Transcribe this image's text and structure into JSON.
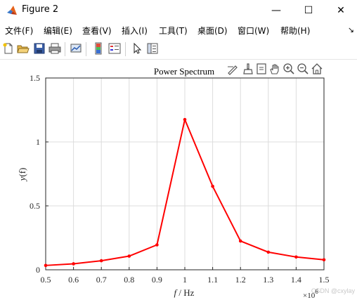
{
  "window": {
    "title": "Figure 2",
    "minimize": "—",
    "maximize": "☐",
    "close": "✕"
  },
  "menu": {
    "items": [
      "文件(F)",
      "编辑(E)",
      "查看(V)",
      "插入(I)",
      "工具(T)",
      "桌面(D)",
      "窗口(W)",
      "帮助(H)"
    ],
    "overflow": "↘"
  },
  "toolbar": {
    "icons": [
      "new-figure-icon",
      "open-file-icon",
      "save-icon",
      "print-icon",
      "link-plot-icon",
      "insert-colorbar-icon",
      "insert-legend-icon",
      "pointer-icon",
      "property-inspector-icon"
    ]
  },
  "axes_toolbar": {
    "icons": [
      "data-tips-icon",
      "brush-icon",
      "export-icon",
      "pan-hand-icon",
      "zoom-in-icon",
      "zoom-out-icon",
      "home-icon"
    ]
  },
  "watermark": "CSDN @cxylay",
  "colors": {
    "line": "#ff0000",
    "grid": "#dcdcdc",
    "axis": "#262626"
  },
  "chart_data": {
    "type": "line",
    "title": "Power Spectrum",
    "xlabel_italic": "f",
    "xlabel_rest": " / Hz",
    "ylabel_italic": "y",
    "ylabel_rest": "(f)",
    "x_exponent_label": "×10",
    "x_exponent": "6",
    "xlim": [
      0.5,
      1.5
    ],
    "ylim": [
      0,
      1.5
    ],
    "xticks": [
      "0.5",
      "0.6",
      "0.7",
      "0.8",
      "0.9",
      "1",
      "1.1",
      "1.2",
      "1.3",
      "1.4",
      "1.5"
    ],
    "yticks": [
      "0",
      "0.5",
      "1",
      "1.5"
    ],
    "grid": true,
    "series": [
      {
        "x": [
          0.5,
          0.6,
          0.7,
          0.8,
          0.9,
          1.0,
          1.1,
          1.2,
          1.3,
          1.4,
          1.5
        ],
        "y": [
          0.034,
          0.047,
          0.071,
          0.107,
          0.195,
          1.175,
          0.653,
          0.225,
          0.138,
          0.1,
          0.078
        ],
        "color": "#ff0000",
        "marker": "dot"
      }
    ]
  }
}
